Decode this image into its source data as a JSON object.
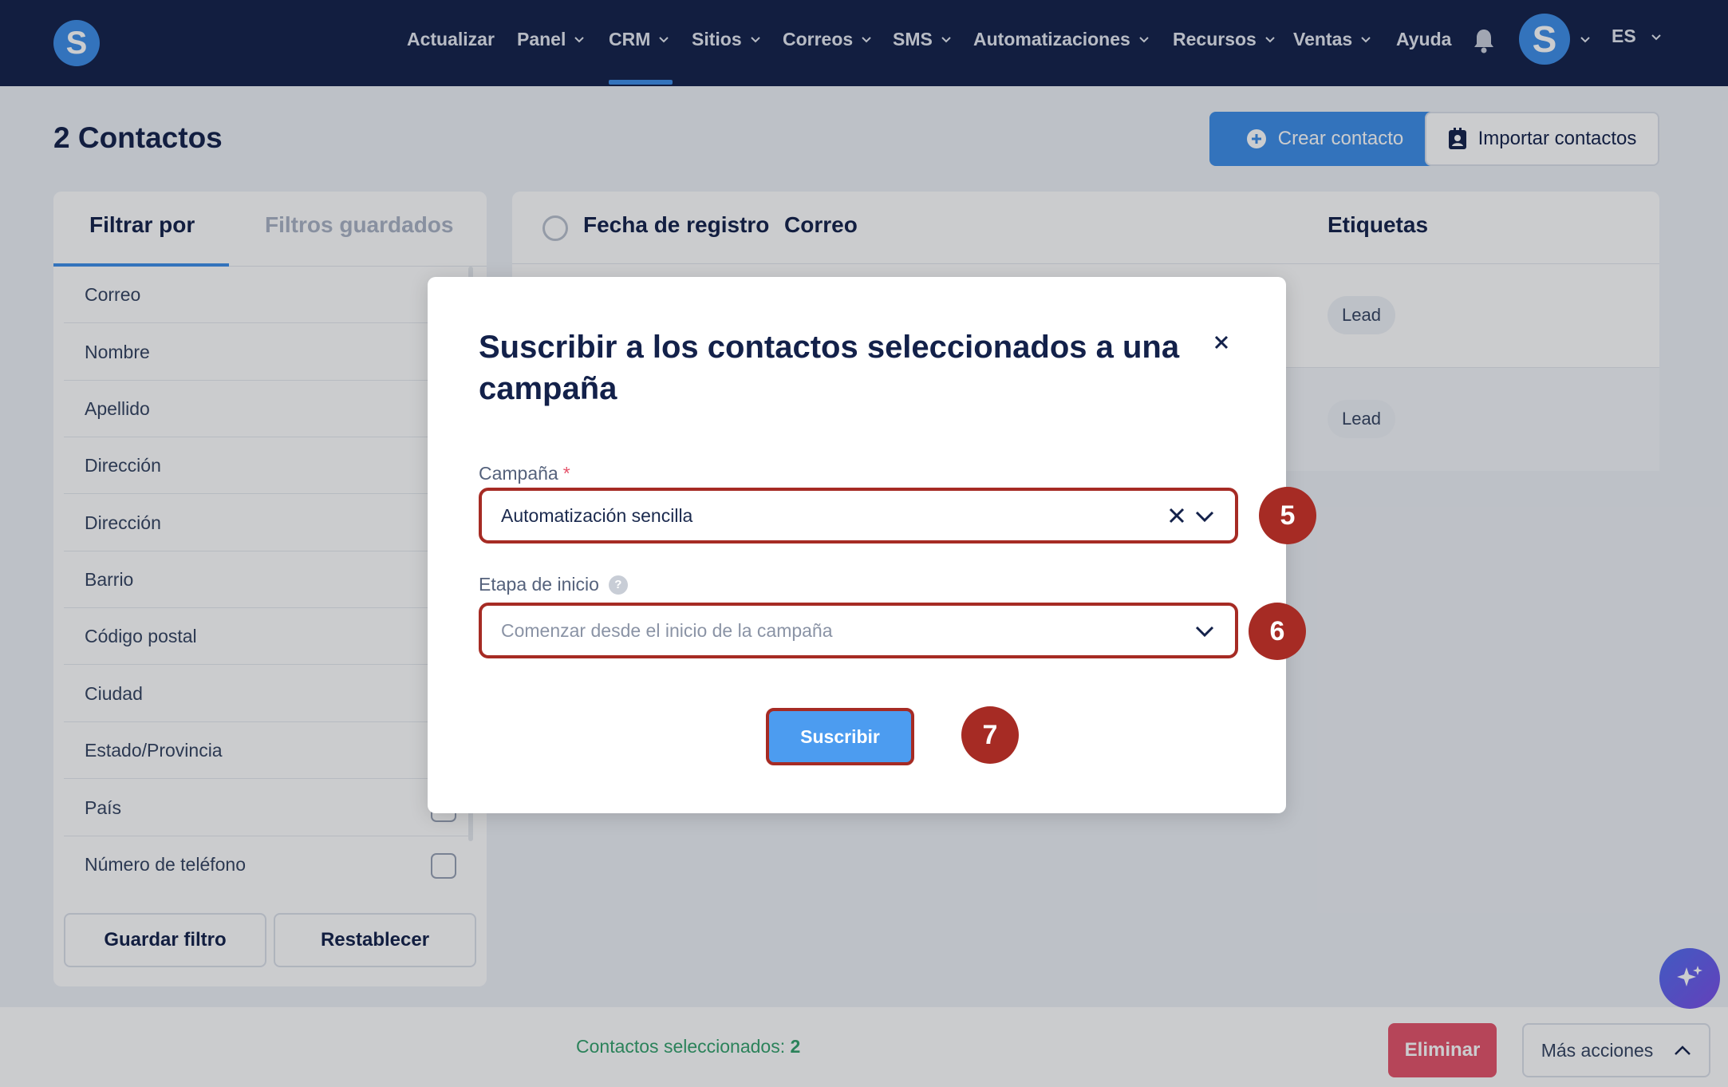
{
  "nav": {
    "items": [
      {
        "label": "Actualizar",
        "dropdown": false
      },
      {
        "label": "Panel",
        "dropdown": true
      },
      {
        "label": "CRM",
        "dropdown": true,
        "active": true
      },
      {
        "label": "Sitios",
        "dropdown": true
      },
      {
        "label": "Correos",
        "dropdown": true
      },
      {
        "label": "SMS",
        "dropdown": true
      },
      {
        "label": "Automatizaciones",
        "dropdown": true
      },
      {
        "label": "Recursos",
        "dropdown": true
      },
      {
        "label": "Ventas",
        "dropdown": true
      },
      {
        "label": "Ayuda",
        "dropdown": false
      }
    ],
    "logo_letter": "S",
    "avatar_letter": "S",
    "language": "ES"
  },
  "header": {
    "title": "2 Contactos",
    "create_button": "Crear contacto",
    "import_button": "Importar contactos"
  },
  "filters": {
    "tabs": [
      "Filtrar por",
      "Filtros guardados"
    ],
    "fields": [
      "Correo",
      "Nombre",
      "Apellido",
      "Dirección",
      "Dirección",
      "Barrio",
      "Código postal",
      "Ciudad",
      "Estado/Provincia",
      "País",
      "Número de teléfono"
    ],
    "save_button": "Guardar filtro",
    "reset_button": "Restablecer"
  },
  "table": {
    "columns": [
      "Fecha de registro",
      "Correo",
      "Etiquetas"
    ],
    "rows": [
      {
        "tag": "Lead"
      },
      {
        "tag": "Lead"
      }
    ]
  },
  "bottom_bar": {
    "selected_label": "Contactos seleccionados:",
    "selected_count": "2",
    "delete_button": "Eliminar",
    "more_actions_button": "Más acciones"
  },
  "modal": {
    "title": "Suscribir a los contactos seleccionados a una campaña",
    "campaign_label": "Campaña",
    "required_mark": "*",
    "campaign_value": "Automatización sencilla",
    "start_stage_label": "Etapa de inicio",
    "start_stage_placeholder": "Comenzar desde el inicio de la campaña",
    "subscribe_button": "Suscribir"
  },
  "steps": [
    "5",
    "6",
    "7"
  ],
  "colors": {
    "navbar": "#13214a",
    "primary": "#3d8ee8",
    "annotation": "#a62b24",
    "danger": "#e5536a",
    "success_text": "#33a06b"
  }
}
